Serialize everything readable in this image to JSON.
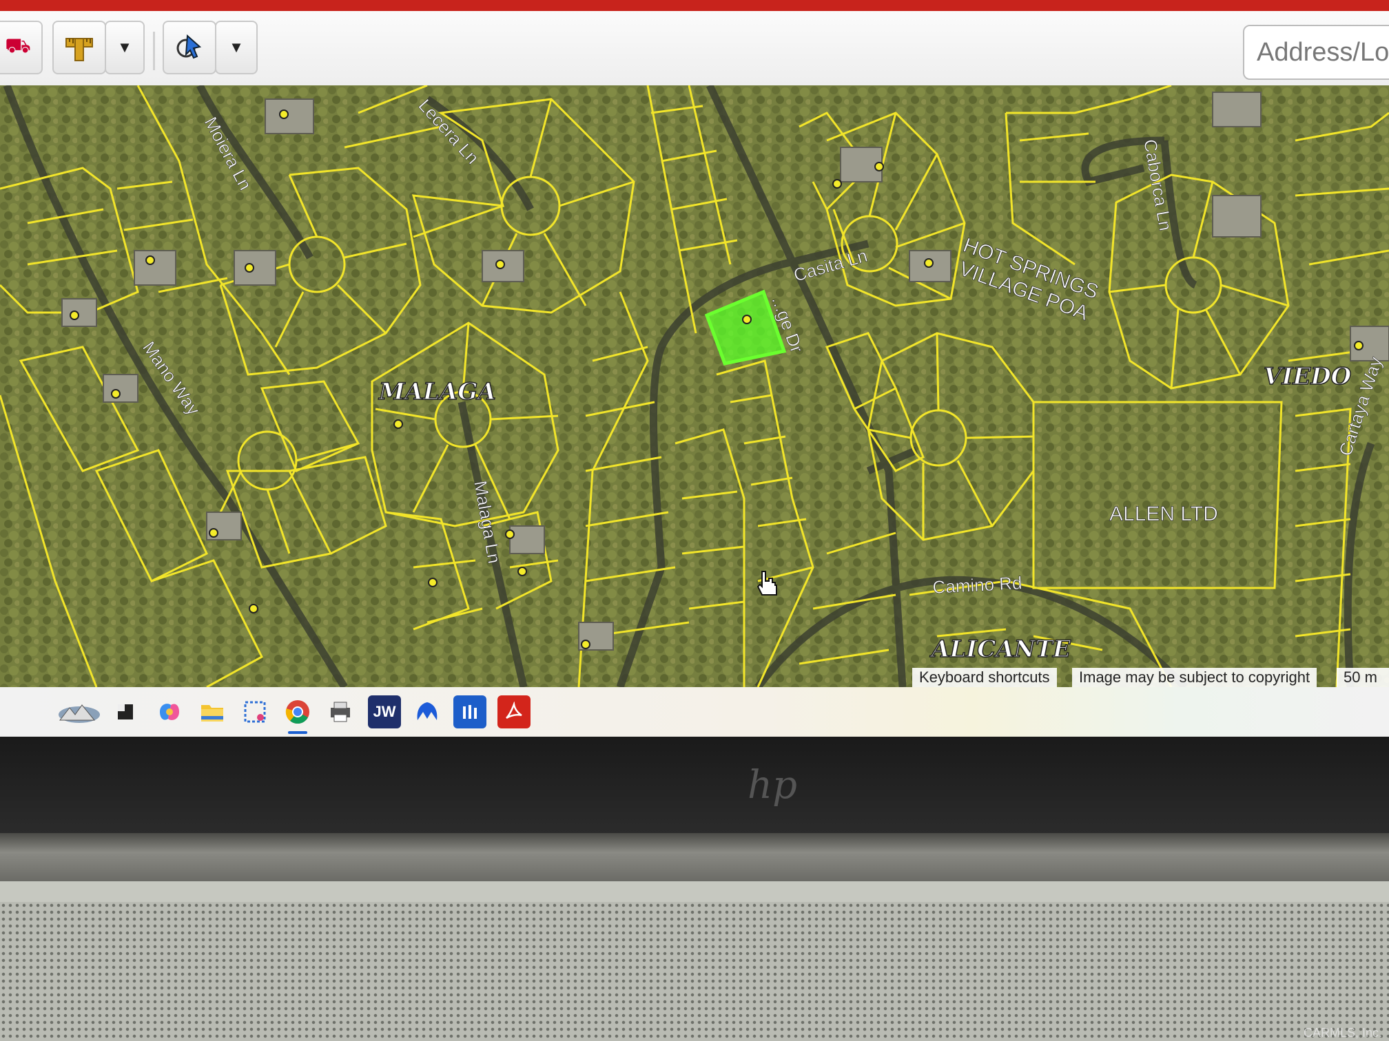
{
  "toolbar": {
    "address_placeholder": "Address/Loc"
  },
  "map": {
    "street_labels": [
      "Moiera Ln",
      "Lecera Ln",
      "Casita Ln",
      "Caborca Ln",
      "Mano Way",
      "Malaga Ln",
      "Camino Rd",
      "Cartaya Way"
    ],
    "subdivision_labels": [
      "MALAGA",
      "VIEDO",
      "ALICANTE"
    ],
    "owner_labels": [
      "HOT SPRINGS",
      "VILLAGE POA",
      "ALLEN LTD"
    ],
    "partial_labels": [
      "...ge Dr"
    ],
    "highlight_color": "#5cff2a",
    "parcel_line_color": "#f2e52a"
  },
  "attribution": {
    "shortcuts": "Keyboard shortcuts",
    "copyright": "Image may be subject to copyright",
    "scale": "50 m"
  },
  "taskbar": {
    "icons": [
      "weather-icon",
      "task-view-icon",
      "copilot-icon",
      "file-explorer-icon",
      "snipping-tool-icon",
      "chrome-icon",
      "printer-icon",
      "jw-icon",
      "malwarebytes-icon",
      "app-icon",
      "acrobat-icon"
    ],
    "jw_label": "JW"
  },
  "device": {
    "logo": "hp"
  },
  "watermark": "CARMLS, Inc."
}
